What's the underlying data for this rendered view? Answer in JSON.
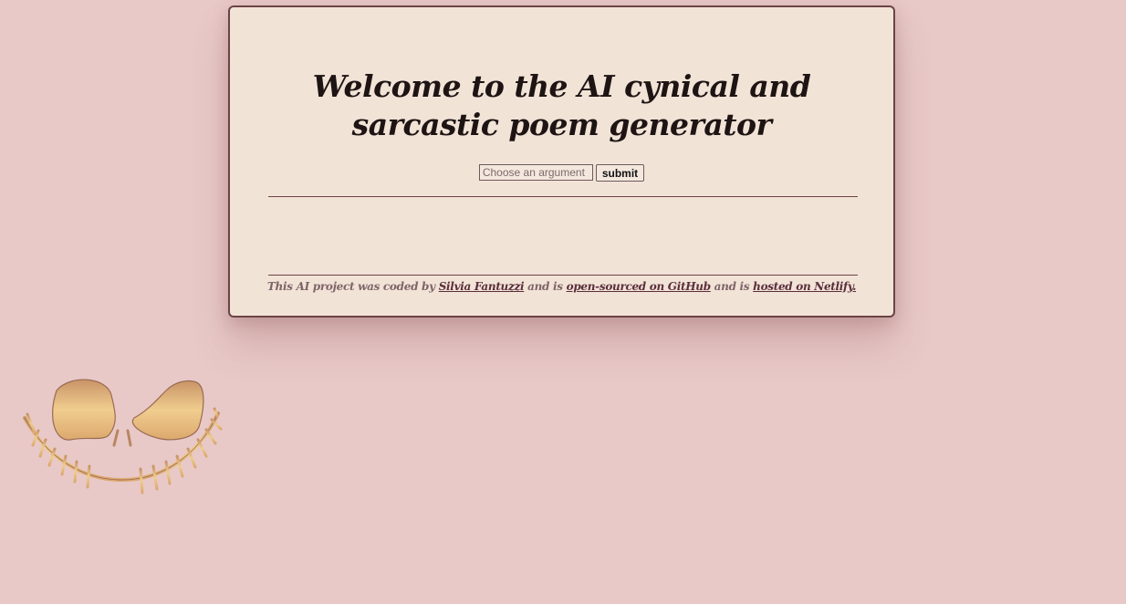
{
  "header": {
    "title": "Welcome to the AI cynical and sarcastic poem generator"
  },
  "form": {
    "input_placeholder": "Choose an argument",
    "input_value": "",
    "submit_label": "submit"
  },
  "poem": {
    "text": ""
  },
  "footer": {
    "text_1": "This AI project was coded by ",
    "author_link": "Silvia Fantuzzi",
    "text_2": " and is ",
    "github_link": "open-sourced on GitHub",
    "text_3": " and is ",
    "netlify_link": "hosted on Netlify."
  },
  "colors": {
    "background": "#e8c9c8",
    "card": "#f2e3d7",
    "border": "#6b4345",
    "face_gold": "#e3b978"
  },
  "decoration": {
    "icon": "smiling-face-icon"
  }
}
